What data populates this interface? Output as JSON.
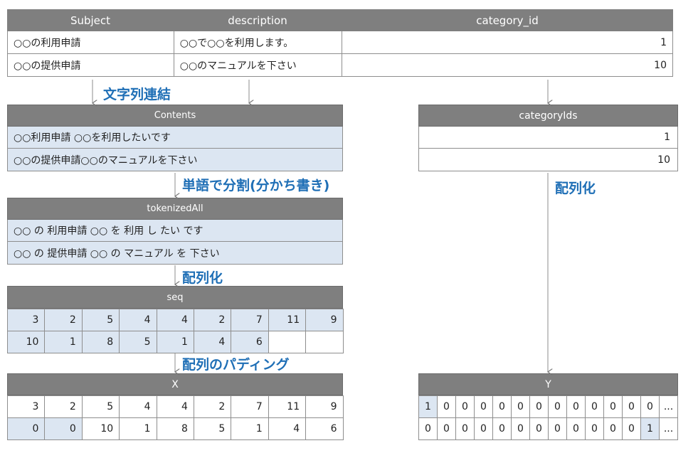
{
  "top_table": {
    "headers": [
      "Subject",
      "description",
      "category_id"
    ],
    "rows": [
      [
        "○○の利用申請",
        "○○で○○を利用します。",
        "1"
      ],
      [
        "○○の提供申請",
        "○○のマニュアルを下さい",
        "10"
      ]
    ]
  },
  "labels": {
    "concat": "文字列連結",
    "tokenize": "単語で分割(分かち書き)",
    "to_array_1": "配列化",
    "to_array_2": "配列化",
    "padding": "配列のパディング"
  },
  "contents": {
    "header": "Contents",
    "rows": [
      "○○利用申請 ○○を利用したいです",
      "○○の提供申請○○のマニュアルを下さい"
    ]
  },
  "tokenized": {
    "header": "tokenizedAll",
    "rows": [
      "○○ の 利用申請 ○○ を 利用 し たい です",
      "○○ の 提供申請 ○○ の マニュアル を 下さい"
    ]
  },
  "seq": {
    "header": "seq",
    "rows": [
      [
        "3",
        "2",
        "5",
        "4",
        "4",
        "2",
        "7",
        "11",
        "9"
      ],
      [
        "10",
        "1",
        "8",
        "5",
        "1",
        "4",
        "6",
        "",
        ""
      ]
    ]
  },
  "x": {
    "header": "X",
    "rows": [
      [
        "3",
        "2",
        "5",
        "4",
        "4",
        "2",
        "7",
        "11",
        "9"
      ],
      [
        "0",
        "0",
        "10",
        "1",
        "8",
        "5",
        "1",
        "4",
        "6"
      ]
    ]
  },
  "category_ids": {
    "header": "categoryIds",
    "rows": [
      "1",
      "10"
    ]
  },
  "y": {
    "header": "Y",
    "rows": [
      [
        "1",
        "0",
        "0",
        "0",
        "0",
        "0",
        "0",
        "0",
        "0",
        "0",
        "0",
        "0",
        "0",
        "..."
      ],
      [
        "0",
        "0",
        "0",
        "0",
        "0",
        "0",
        "0",
        "0",
        "0",
        "0",
        "0",
        "0",
        "1",
        "..."
      ]
    ]
  },
  "colors": {
    "header_bg": "#7f7f7f",
    "row_blue": "#dce6f2",
    "label_blue": "#1f6fb6"
  }
}
